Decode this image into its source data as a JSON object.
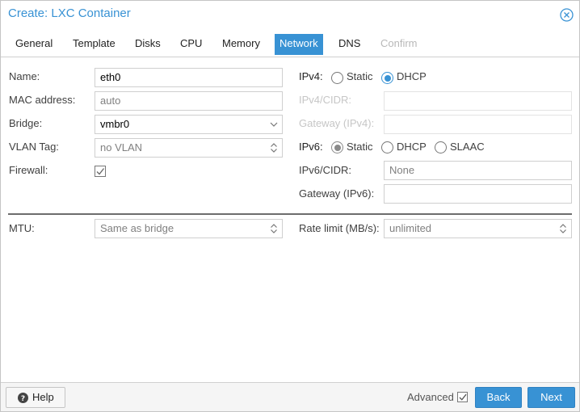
{
  "window": {
    "title": "Create: LXC Container"
  },
  "tabs": [
    {
      "label": "General"
    },
    {
      "label": "Template"
    },
    {
      "label": "Disks"
    },
    {
      "label": "CPU"
    },
    {
      "label": "Memory"
    },
    {
      "label": "Network",
      "active": true
    },
    {
      "label": "DNS"
    },
    {
      "label": "Confirm",
      "disabled": true
    }
  ],
  "left": {
    "name_label": "Name:",
    "name_value": "eth0",
    "mac_label": "MAC address:",
    "mac_placeholder": "auto",
    "bridge_label": "Bridge:",
    "bridge_value": "vmbr0",
    "vlan_label": "VLAN Tag:",
    "vlan_placeholder": "no VLAN",
    "firewall_label": "Firewall:",
    "firewall_checked": true
  },
  "right": {
    "ipv4_label": "IPv4:",
    "ipv4_options": [
      "Static",
      "DHCP"
    ],
    "ipv4_selected": "DHCP",
    "ipv4_cidr_label": "IPv4/CIDR:",
    "gateway4_label": "Gateway (IPv4):",
    "ipv6_label": "IPv6:",
    "ipv6_options": [
      "Static",
      "DHCP",
      "SLAAC"
    ],
    "ipv6_selected": "Static",
    "ipv6_cidr_label": "IPv6/CIDR:",
    "ipv6_cidr_value": "None",
    "gateway6_label": "Gateway (IPv6):",
    "gateway6_value": ""
  },
  "advanced": {
    "mtu_label": "MTU:",
    "mtu_placeholder": "Same as bridge",
    "rate_label": "Rate limit (MB/s):",
    "rate_placeholder": "unlimited"
  },
  "footer": {
    "help_label": "Help",
    "advanced_label": "Advanced",
    "advanced_checked": true,
    "back_label": "Back",
    "next_label": "Next"
  },
  "colors": {
    "accent": "#3892d4",
    "text": "#404040",
    "disabled": "#c6c6c6"
  }
}
